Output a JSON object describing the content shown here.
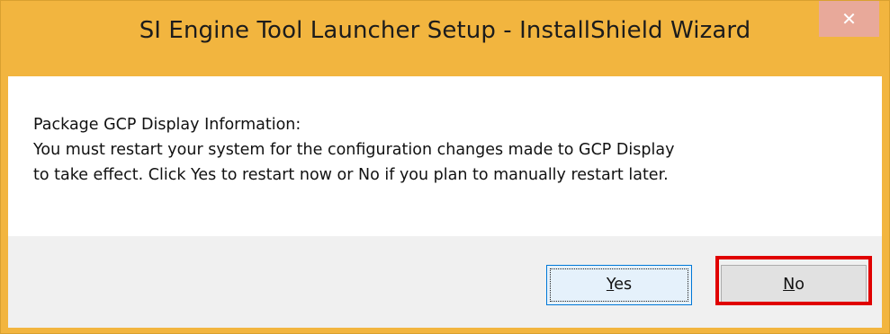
{
  "window": {
    "title": "SI Engine Tool Launcher Setup - InstallShield Wizard",
    "close_glyph": "✕"
  },
  "message": {
    "line1": "Package GCP Display Information:",
    "line2": "You must restart your system for the configuration changes made to GCP Display",
    "line3": "to take effect. Click Yes to restart now or No if you plan to manually restart later."
  },
  "buttons": {
    "yes": {
      "label_mnemonic": "Y",
      "label_rest": "es"
    },
    "no": {
      "label_mnemonic": "N",
      "label_rest": "o"
    }
  },
  "colors": {
    "titlebar": "#f2b53f",
    "close_button": "#e8a99a",
    "highlight": "#e00000"
  }
}
